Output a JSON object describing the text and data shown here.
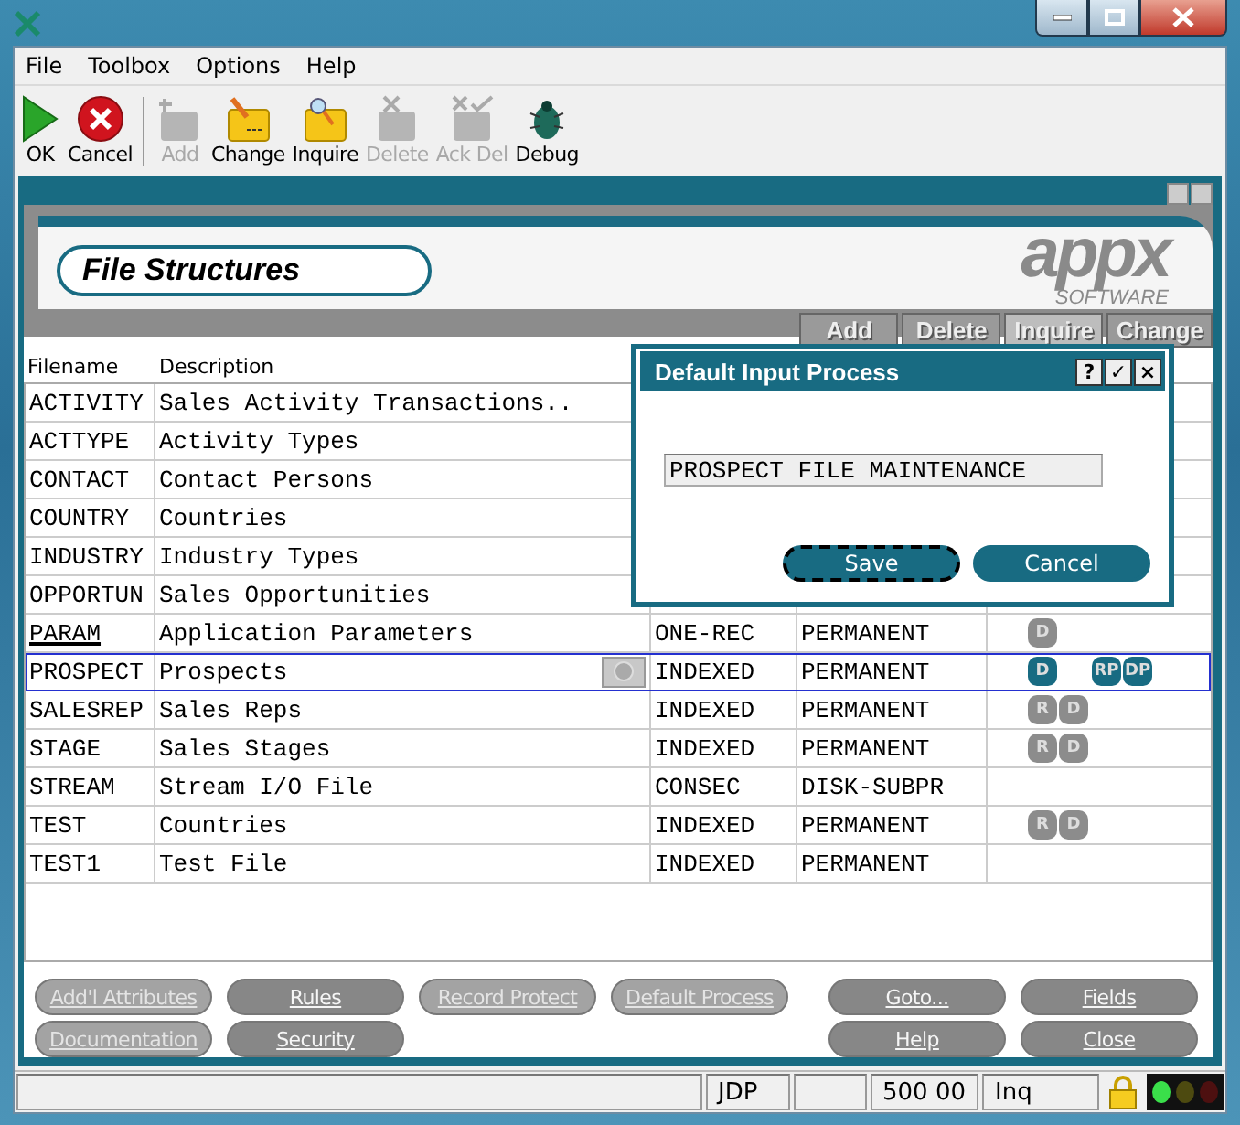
{
  "menu": [
    {
      "label": "File"
    },
    {
      "label": "Toolbox"
    },
    {
      "label": "Options"
    },
    {
      "label": "Help"
    }
  ],
  "toolbar": [
    {
      "kind": "ok",
      "label": "OK",
      "disabled": false
    },
    {
      "kind": "cancel",
      "label": "Cancel",
      "disabled": false
    },
    {
      "kind": "add",
      "label": "Add",
      "disabled": true
    },
    {
      "kind": "change",
      "label": "Change",
      "disabled": false
    },
    {
      "kind": "inquire",
      "label": "Inquire",
      "disabled": false
    },
    {
      "kind": "delete",
      "label": "Delete",
      "disabled": true
    },
    {
      "kind": "ackdel",
      "label": "Ack Del",
      "disabled": true
    },
    {
      "kind": "debug",
      "label": "Debug",
      "disabled": false
    }
  ],
  "header": {
    "title": "File Structures",
    "logo": "appx",
    "logo_sub": "SOFTWARE"
  },
  "mode_buttons": [
    {
      "label": "Add",
      "selected": false
    },
    {
      "label": "Delete",
      "selected": false
    },
    {
      "label": "Inquire",
      "selected": true
    },
    {
      "label": "Change",
      "selected": false
    }
  ],
  "table": {
    "columns": [
      "Filename",
      "Description"
    ],
    "rows": [
      {
        "name": "ACTIVITY",
        "description": "Sales Activity Transactions..",
        "selected": false,
        "focused": false
      },
      {
        "name": "ACTTYPE",
        "description": "Activity Types",
        "selected": false,
        "focused": false
      },
      {
        "name": "CONTACT",
        "description": "Contact Persons",
        "selected": false,
        "focused": false
      },
      {
        "name": "COUNTRY",
        "description": "Countries",
        "selected": false,
        "focused": false
      },
      {
        "name": "INDUSTRY",
        "description": "Industry Types",
        "selected": false,
        "focused": false
      },
      {
        "name": "OPPORTUN",
        "description": "Sales Opportunities",
        "selected": false,
        "focused": false
      },
      {
        "name": "PARAM",
        "description": "Application Parameters",
        "type": "ONE-REC",
        "class": "PERMANENT",
        "selected": false,
        "focused": true,
        "flags": [
          {
            "label": "D",
            "active": false
          }
        ]
      },
      {
        "name": "PROSPECT",
        "description": "Prospects",
        "type": "INDEXED",
        "class": "PERMANENT",
        "selected": true,
        "focused": false,
        "flags": [
          {
            "label": "D",
            "active": true
          },
          {
            "label": "RP",
            "active": true
          },
          {
            "label": "DP",
            "active": true
          }
        ]
      },
      {
        "name": "SALESREP",
        "description": "Sales Reps",
        "type": "INDEXED",
        "class": "PERMANENT",
        "selected": false,
        "focused": false,
        "flags": [
          {
            "label": "R",
            "active": false
          },
          {
            "label": "D",
            "active": false
          }
        ]
      },
      {
        "name": "STAGE",
        "description": "Sales Stages",
        "type": "INDEXED",
        "class": "PERMANENT",
        "selected": false,
        "focused": false,
        "flags": [
          {
            "label": "R",
            "active": false
          },
          {
            "label": "D",
            "active": false
          }
        ]
      },
      {
        "name": "STREAM",
        "description": "Stream I/O File",
        "type": "CONSEC",
        "class": "DISK-SUBPR",
        "selected": false,
        "focused": false
      },
      {
        "name": "TEST",
        "description": "Countries",
        "type": "INDEXED",
        "class": "PERMANENT",
        "selected": false,
        "focused": false,
        "flags": [
          {
            "label": "R",
            "active": false
          },
          {
            "label": "D",
            "active": false
          }
        ]
      },
      {
        "name": "TEST1",
        "description": "Test File",
        "type": "INDEXED",
        "class": "PERMANENT",
        "selected": false,
        "focused": false
      }
    ]
  },
  "dialog": {
    "title": "Default Input Process",
    "title_buttons": [
      "?",
      "✓",
      "×"
    ],
    "value": "PROSPECT FILE MAINTENANCE",
    "buttons": [
      {
        "label": "Save",
        "focused": true
      },
      {
        "label": "Cancel",
        "focused": false
      }
    ]
  },
  "bottom_buttons": {
    "left": [
      {
        "label": "Add'l Attributes",
        "disabled": true
      },
      {
        "label": "Rules",
        "disabled": false
      },
      {
        "label": "Record Protect",
        "disabled": true
      },
      {
        "label": "Default Process",
        "disabled": true
      },
      {
        "label": "Documentation",
        "disabled": true
      },
      {
        "label": "Security",
        "disabled": false
      }
    ],
    "right": [
      {
        "label": "Goto...",
        "disabled": false
      },
      {
        "label": "Fields",
        "disabled": false
      },
      {
        "label": "Help",
        "disabled": false
      },
      {
        "label": "Close",
        "disabled": false
      }
    ]
  },
  "status_bar": {
    "cells": [
      "",
      "JDP",
      "",
      "500 00",
      "Inq"
    ]
  }
}
